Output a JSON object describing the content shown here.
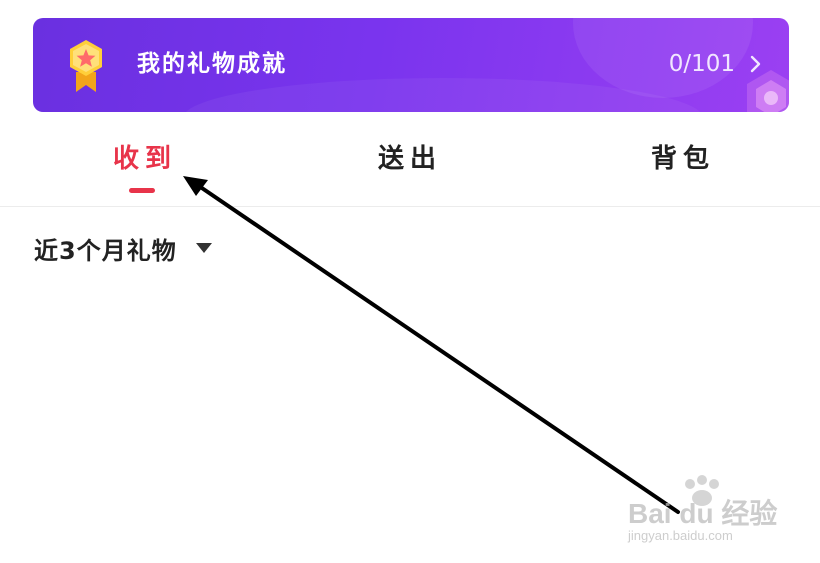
{
  "banner": {
    "title": "我的礼物成就",
    "progress": "0/101",
    "icon": "medal-star-icon",
    "colors": {
      "start": "#6a30e0",
      "end": "#9b40f2"
    }
  },
  "tabs": [
    {
      "label": "收到",
      "active": true
    },
    {
      "label": "送出",
      "active": false
    },
    {
      "label": "背包",
      "active": false
    }
  ],
  "filter": {
    "label": "近3个月礼物",
    "icon": "caret-down-icon"
  },
  "annotation": {
    "type": "arrow",
    "color": "#000000"
  },
  "watermark": {
    "brand": "Bai du 经验",
    "url": "jingyan.baidu.com"
  },
  "colors": {
    "accent": "#e8344a",
    "text": "#222222",
    "divider": "#ececec"
  }
}
